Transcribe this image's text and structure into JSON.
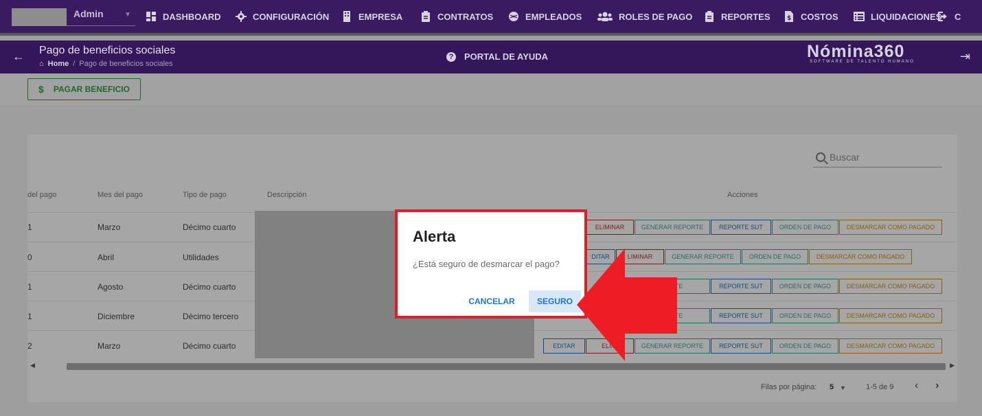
{
  "topnav": {
    "user_name": "Admin",
    "items": [
      {
        "label": "DASHBOARD",
        "icon": "dashboard-icon"
      },
      {
        "label": "CONFIGURACIÓN",
        "icon": "gear-icon"
      },
      {
        "label": "EMPRESA",
        "icon": "building-icon"
      },
      {
        "label": "CONTRATOS",
        "icon": "clipboard-icon"
      },
      {
        "label": "EMPLEADOS",
        "icon": "globe-icon"
      },
      {
        "label": "ROLES DE PAGO",
        "icon": "users-icon"
      },
      {
        "label": "REPORTES",
        "icon": "clipboard-icon"
      },
      {
        "label": "COSTOS",
        "icon": "dollar-file-icon"
      },
      {
        "label": "LIQUIDACIONES",
        "icon": "list-icon"
      },
      {
        "label": "C",
        "icon": "logout-icon"
      }
    ]
  },
  "subbar": {
    "title": "Pago de beneficios sociales",
    "breadcrumb_home": "Home",
    "breadcrumb_sep": "/",
    "breadcrumb_current": "Pago de beneficios sociales",
    "help_label": "PORTAL DE AYUDA",
    "brand_name": "Nómina360",
    "brand_tagline": "SOFTWARE DE TALENTO HUMANO"
  },
  "toolbar": {
    "pay_label": "PAGAR BENEFICIO",
    "pay_icon": "$"
  },
  "table": {
    "search_placeholder": "Buscar",
    "headers": {
      "col_partial": "del pago",
      "mes": "Mes del pago",
      "tipo": "Tipo de pago",
      "descripcion": "Descripción",
      "acciones": "Acciones"
    },
    "rows": [
      {
        "partial": "1",
        "mes": "Marzo",
        "tipo": "Décimo cuarto"
      },
      {
        "partial": "0",
        "mes": "Abril",
        "tipo": "Utilidades"
      },
      {
        "partial": "1",
        "mes": "Agosto",
        "tipo": "Décimo cuarto"
      },
      {
        "partial": "1",
        "mes": "Diciembre",
        "tipo": "Décimo tercero"
      },
      {
        "partial": "2",
        "mes": "Marzo",
        "tipo": "Décimo cuarto"
      }
    ],
    "actions": {
      "editar": "EDITAR",
      "editar_partial": "DITAR",
      "eliminar": "ELIMINAR",
      "eliminar_partial": "ELIMI",
      "eliminar_partial2": "LIMINAR",
      "generar": "GENERAR REPORTE",
      "generar_partial": "PORTE",
      "sut": "REPORTE SUT",
      "orden": "ORDEN DE PAGO",
      "desmarcar": "DESMARCAR COMO PAGADO"
    },
    "pagination": {
      "rows_per_page_label": "Filas por página:",
      "rows_per_page": "5",
      "range": "1-5 de 9",
      "prev": "‹",
      "next": "›"
    }
  },
  "modal": {
    "title": "Alerta",
    "message": "¿Está seguro de desmarcar el pago?",
    "cancel_label": "CANCELAR",
    "confirm_label": "SEGURO"
  },
  "colors": {
    "nav_purple": "#5b2c9a",
    "highlight_red": "#e31d24",
    "action_blue": "#1976d2"
  }
}
